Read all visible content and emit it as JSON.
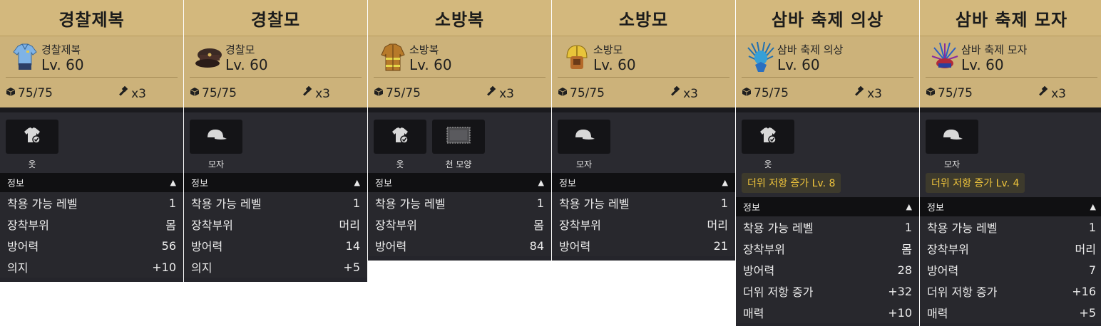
{
  "cards": [
    {
      "title": "경찰제복",
      "name": "경찰제복",
      "level": "Lv. 60",
      "durability": "75/75",
      "repair": "x3",
      "icon": "police-uniform-icon",
      "slots": [
        {
          "label": "옷",
          "icon": "shirt-icon"
        }
      ],
      "effect": "",
      "info_label": "정보",
      "stats": [
        {
          "label": "착용 가능 레벨",
          "value": "1"
        },
        {
          "label": "장착부위",
          "value": "몸"
        },
        {
          "label": "방어력",
          "value": "56"
        },
        {
          "label": "의지",
          "value": "+10"
        }
      ]
    },
    {
      "title": "경찰모",
      "name": "경찰모",
      "level": "Lv. 60",
      "durability": "75/75",
      "repair": "x3",
      "icon": "police-cap-icon",
      "slots": [
        {
          "label": "모자",
          "icon": "cap-icon"
        }
      ],
      "effect": "",
      "info_label": "정보",
      "stats": [
        {
          "label": "착용 가능 레벨",
          "value": "1"
        },
        {
          "label": "장착부위",
          "value": "머리"
        },
        {
          "label": "방어력",
          "value": "14"
        },
        {
          "label": "의지",
          "value": "+5"
        }
      ]
    },
    {
      "title": "소방복",
      "name": "소방복",
      "level": "Lv. 60",
      "durability": "75/75",
      "repair": "x3",
      "icon": "firefighter-suit-icon",
      "slots": [
        {
          "label": "옷",
          "icon": "shirt-icon"
        },
        {
          "label": "천 모양",
          "icon": "cloth-pattern-icon"
        }
      ],
      "effect": "",
      "info_label": "정보",
      "stats": [
        {
          "label": "착용 가능 레벨",
          "value": "1"
        },
        {
          "label": "장착부위",
          "value": "몸"
        },
        {
          "label": "방어력",
          "value": "84"
        }
      ]
    },
    {
      "title": "소방모",
      "name": "소방모",
      "level": "Lv. 60",
      "durability": "75/75",
      "repair": "x3",
      "icon": "fire-helmet-icon",
      "slots": [
        {
          "label": "모자",
          "icon": "cap-icon"
        }
      ],
      "effect": "",
      "info_label": "정보",
      "stats": [
        {
          "label": "착용 가능 레벨",
          "value": "1"
        },
        {
          "label": "장착부위",
          "value": "머리"
        },
        {
          "label": "방어력",
          "value": "21"
        }
      ]
    },
    {
      "title": "삼바 축제 의상",
      "name": "삼바 축제 의상",
      "level": "Lv. 60",
      "durability": "75/75",
      "repair": "x3",
      "icon": "samba-costume-icon",
      "slots": [
        {
          "label": "옷",
          "icon": "shirt-icon"
        }
      ],
      "effect": "더위 저항 증가 Lv. 8",
      "info_label": "정보",
      "stats": [
        {
          "label": "착용 가능 레벨",
          "value": "1"
        },
        {
          "label": "장착부위",
          "value": "몸"
        },
        {
          "label": "방어력",
          "value": "28"
        },
        {
          "label": "더위 저항 증가",
          "value": "+32"
        },
        {
          "label": "매력",
          "value": "+10"
        }
      ]
    },
    {
      "title": "삼바 축제 모자",
      "name": "삼바 축제 모자",
      "level": "Lv. 60",
      "durability": "75/75",
      "repair": "x3",
      "icon": "samba-hat-icon",
      "slots": [
        {
          "label": "모자",
          "icon": "cap-icon"
        }
      ],
      "effect": "더위 저항 증가 Lv. 4",
      "info_label": "정보",
      "stats": [
        {
          "label": "착용 가능 레벨",
          "value": "1"
        },
        {
          "label": "장착부위",
          "value": "머리"
        },
        {
          "label": "방어력",
          "value": "7"
        },
        {
          "label": "더위 저항 증가",
          "value": "+16"
        },
        {
          "label": "매력",
          "value": "+5"
        }
      ]
    }
  ]
}
